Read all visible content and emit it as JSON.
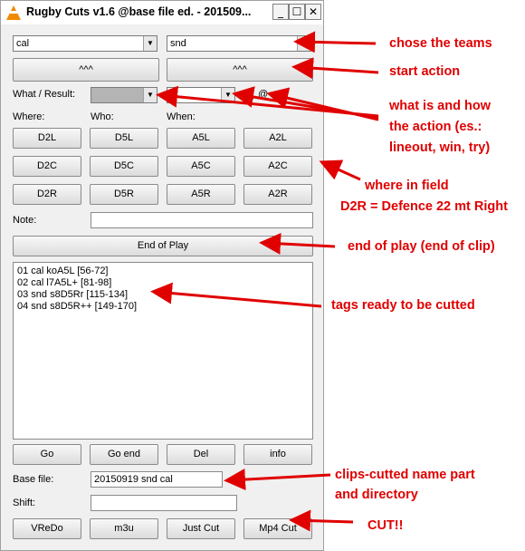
{
  "window": {
    "title": "Rugby Cuts v1.6 @base file ed. - 201509...",
    "min_label": "_",
    "max_label": "☐",
    "close_label": "✕"
  },
  "teams": {
    "team_a": "cal",
    "team_b": "snd",
    "start_a": "^^^",
    "start_b": "^^^"
  },
  "what_result": {
    "label": "What / Result:",
    "what_value": "",
    "result_value": "",
    "checkbox_label": "@"
  },
  "columns": {
    "where": "Where:",
    "who": "Who:",
    "when": "When:"
  },
  "zone_buttons": [
    [
      "D2L",
      "D5L",
      "A5L",
      "A2L"
    ],
    [
      "D2C",
      "D5C",
      "A5C",
      "A2C"
    ],
    [
      "D2R",
      "D5R",
      "A5R",
      "A2R"
    ]
  ],
  "note": {
    "label": "Note:",
    "value": ""
  },
  "end_of_play": "End of Play",
  "tags": [
    "01 cal koA5L [56-72]",
    "02 cal l7A5L+ [81-98]",
    "03 snd s8D5Rr [115-134]",
    "04 snd s8D5R++ [149-170]"
  ],
  "list_actions": {
    "go": "Go",
    "go_end": "Go end",
    "del": "Del",
    "info": "info"
  },
  "base_file": {
    "label": "Base file:",
    "value": "20150919 snd cal"
  },
  "shift": {
    "label": "Shift:",
    "value": ""
  },
  "bottom_actions": {
    "vredo": "VReDo",
    "m3u": "m3u",
    "just_cut": "Just Cut",
    "mp4_cut": "Mp4 Cut"
  },
  "annotations": {
    "teams": "chose the teams",
    "start": "start action",
    "what_line1": "what is and how",
    "what_line2": "the action (es.:",
    "what_line3": "lineout, win, try)",
    "field_line1": "where in field",
    "field_line2": "D2R = Defence 22 mt Right",
    "end": "end of play (end of clip)",
    "tags": "tags ready to be cutted",
    "clips_line1": "clips-cutted name part",
    "clips_line2": "and directory",
    "cut": "CUT!!"
  },
  "colors": {
    "annotation": "#e00000",
    "icon": "#f08a00"
  }
}
